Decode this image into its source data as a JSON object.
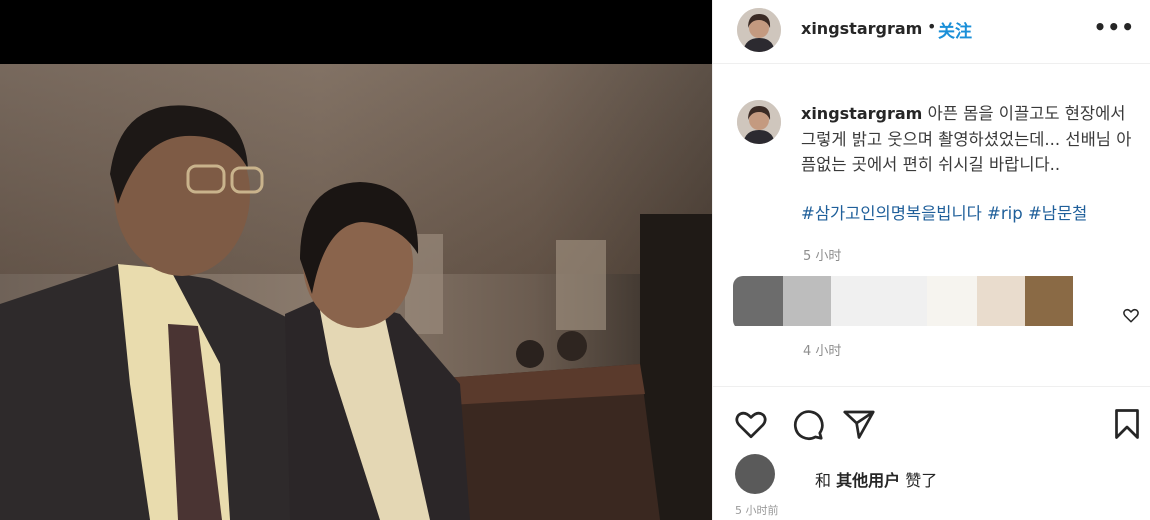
{
  "post": {
    "username": "xingstargram",
    "follow_separator": "•",
    "follow_label": "关注",
    "more_label": "•••"
  },
  "caption": {
    "username": "xingstargram",
    "text": "아픈 몸을 이끌고도 현장에서 그렇게 밝고 웃으며 촬영하셨었는데... 선배님 아픔없는 곳에서 편히 쉬시길 바랍니다..",
    "hashtags": "#삼가고인의명복을빕니다 #rip #남문철",
    "time": "5 小时"
  },
  "comment": {
    "time": "4 小时"
  },
  "likes": {
    "prefix": "和",
    "others": "其他用户",
    "suffix": "赞了",
    "time": "5 小时前"
  },
  "colors": {
    "follow": "#1a8fd8",
    "hashtag": "#1f5f9a",
    "muted": "#8e8e8e",
    "border": "#efefef"
  },
  "icons": {
    "like": "heart-icon",
    "comment": "comment-icon",
    "share": "send-icon",
    "save": "bookmark-icon",
    "comment_like": "small-heart-icon",
    "more": "more-options-icon"
  }
}
